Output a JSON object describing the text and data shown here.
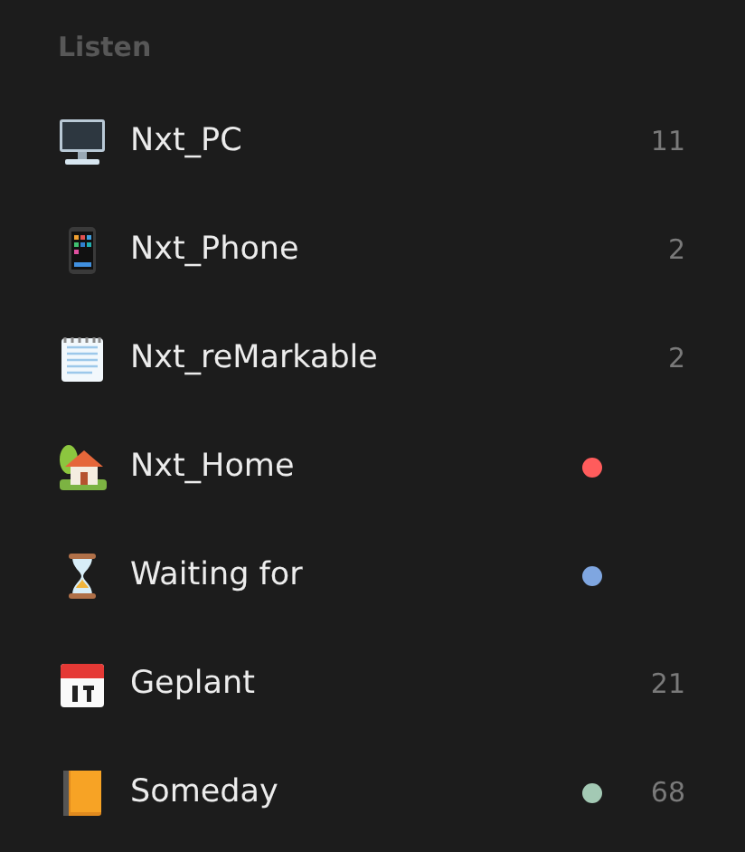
{
  "section": {
    "title": "Listen"
  },
  "lists": [
    {
      "name": "Nxt_PC",
      "count": "11"
    },
    {
      "name": "Nxt_Phone",
      "count": "2"
    },
    {
      "name": "Nxt_reMarkable",
      "count": "2"
    },
    {
      "name": "Nxt_Home",
      "color": "#ff5c5c"
    },
    {
      "name": "Waiting for",
      "color": "#7fa6e0"
    },
    {
      "name": "Geplant",
      "count": "21"
    },
    {
      "name": "Someday",
      "color": "#a3c9b4",
      "count": "68"
    }
  ]
}
